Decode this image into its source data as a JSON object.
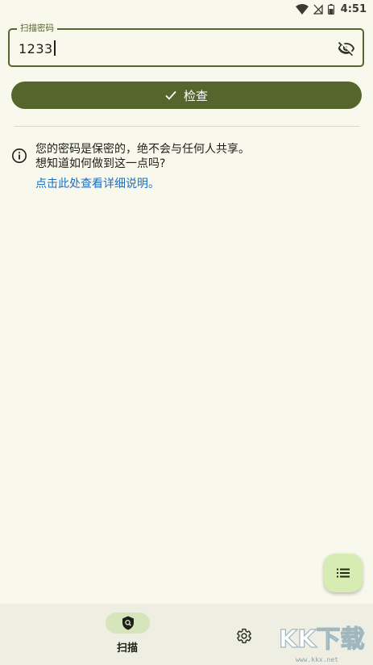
{
  "status_bar": {
    "time": "4:51",
    "icons": [
      "wifi-icon",
      "no-signal-icon",
      "battery-icon"
    ]
  },
  "password_field": {
    "label": "扫描密码",
    "value": "1233",
    "toggle_icon": "eye-off-icon"
  },
  "check_button": {
    "label": "检查",
    "icon": "check-icon"
  },
  "info": {
    "icon": "info-icon",
    "line1": "您的密码是保密的，绝不会与任何人共享。",
    "line2": "想知道如何做到这一点吗?",
    "link": "点击此处查看详细说明。"
  },
  "fab": {
    "icon": "list-icon"
  },
  "bottom_nav": {
    "items": [
      {
        "label": "扫描",
        "icon": "shield-search-icon",
        "selected": true
      },
      {
        "label": "",
        "icon": "gear-icon",
        "selected": false
      }
    ]
  },
  "watermark": {
    "text": "KK下载",
    "url": "www.kkx.net"
  },
  "colors": {
    "background": "#f9f8ec",
    "primary": "#55652c",
    "link": "#1d6fbd",
    "fab": "#d6ecb3",
    "nav_bar": "#eeeee2",
    "nav_indicator": "#d6e5bb"
  }
}
